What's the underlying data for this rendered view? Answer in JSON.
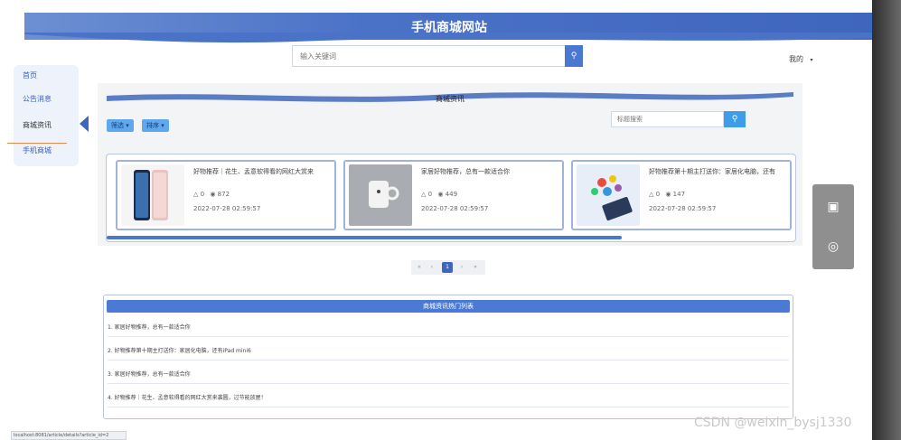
{
  "header": {
    "title": "手机商城网站"
  },
  "search": {
    "placeholder": "输入关键词",
    "icon": "search-icon"
  },
  "user": {
    "label": "我的",
    "caret": "▾"
  },
  "sidebar": {
    "items": [
      {
        "label": "首页"
      },
      {
        "label": "公告消息"
      },
      {
        "label": "商城资讯"
      },
      {
        "label": "手机商城"
      }
    ]
  },
  "main": {
    "section_title": "商城资讯",
    "filter_label": "筛选",
    "sort_label": "排序",
    "filter_placeholder": "标题搜索",
    "cards": [
      {
        "title": "好物推荐｜花生、孟意软得看的网红大赏来",
        "likes": "0",
        "views": "872",
        "date": "2022-07-28 02:59:57"
      },
      {
        "title": "家居好物推荐，总有一款适合你",
        "likes": "0",
        "views": "449",
        "date": "2022-07-28 02:59:57"
      },
      {
        "title": "好物推荐第十期主打送你：家居化电脑，还有",
        "likes": "0",
        "views": "147",
        "date": "2022-07-28 02:59:57"
      }
    ],
    "pager": {
      "first": "«",
      "prev": "‹",
      "current": "1",
      "next": "›",
      "last": "»"
    }
  },
  "list": {
    "title": "商城资讯热门列表",
    "rows": [
      "1. 家居好物推荐，总有一款适合你",
      "2. 好物推荐第十期主打送你：家居化电脑，还有iPad mini6",
      "3. 家居好物推荐，总有一款适合你",
      "4. 好物推荐｜花生、孟意软得看的网红大赏来袭圆，过节能放屋！"
    ]
  },
  "statusbar": {
    "url": "localhost:8081/article/details?article_id=2"
  },
  "watermark": {
    "text": "CSDN @weixin_bysj1330"
  },
  "colors": {
    "primary": "#3f66bd",
    "accent": "#5fa8ee",
    "header": "#4a72c7"
  }
}
